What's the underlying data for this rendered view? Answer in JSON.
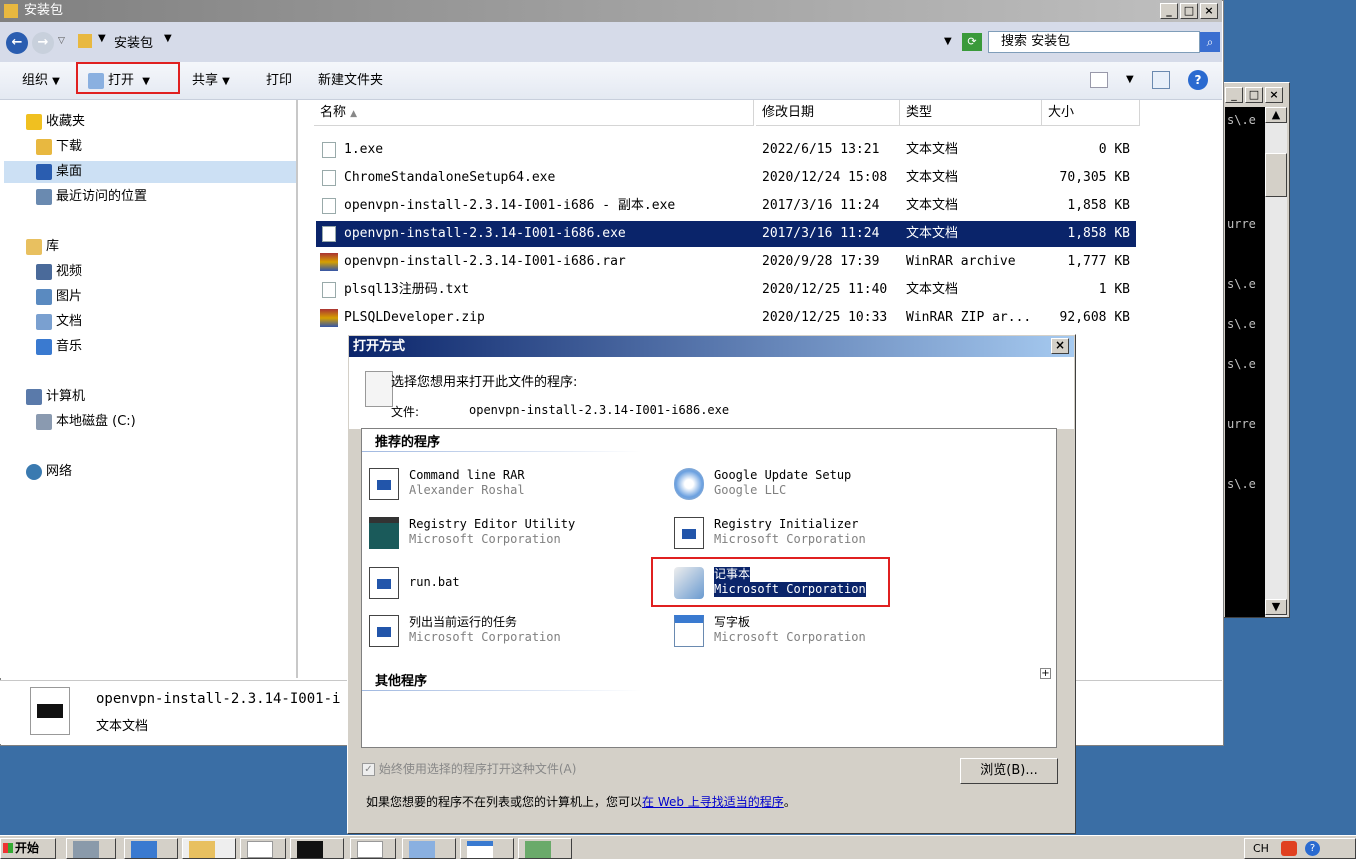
{
  "window": {
    "title": "安装包"
  },
  "address": {
    "breadcrumb": "安装包",
    "search_placeholder": "搜索 安装包"
  },
  "toolbar": {
    "organize": "组织",
    "open": "打开",
    "share": "共享",
    "print": "打印",
    "new_folder": "新建文件夹"
  },
  "nav": {
    "favorites": "收藏夹",
    "downloads": "下载",
    "desktop": "桌面",
    "recent": "最近访问的位置",
    "libraries": "库",
    "videos": "视频",
    "pictures": "图片",
    "documents": "文档",
    "music": "音乐",
    "computer": "计算机",
    "local_disk": "本地磁盘 (C:)",
    "network": "网络"
  },
  "columns": {
    "name": "名称",
    "modified": "修改日期",
    "type": "类型",
    "size": "大小"
  },
  "files": [
    {
      "name": "1.exe",
      "date": "2022/6/15 13:21",
      "type": "文本文档",
      "size": "0 KB"
    },
    {
      "name": "ChromeStandaloneSetup64.exe",
      "date": "2020/12/24 15:08",
      "type": "文本文档",
      "size": "70,305 KB"
    },
    {
      "name": "openvpn-install-2.3.14-I001-i686 - 副本.exe",
      "date": "2017/3/16 11:24",
      "type": "文本文档",
      "size": "1,858 KB"
    },
    {
      "name": "openvpn-install-2.3.14-I001-i686.exe",
      "date": "2017/3/16 11:24",
      "type": "文本文档",
      "size": "1,858 KB"
    },
    {
      "name": "openvpn-install-2.3.14-I001-i686.rar",
      "date": "2020/9/28 17:39",
      "type": "WinRAR archive",
      "size": "1,777 KB"
    },
    {
      "name": "plsql13注册码.txt",
      "date": "2020/12/25 11:40",
      "type": "文本文档",
      "size": "1 KB"
    },
    {
      "name": "PLSQLDeveloper.zip",
      "date": "2020/12/25 10:33",
      "type": "WinRAR ZIP ar...",
      "size": "92,608 KB"
    }
  ],
  "details": {
    "name": "openvpn-install-2.3.14-I001-i",
    "type": "文本文档"
  },
  "dialog": {
    "title": "打开方式",
    "prompt": "选择您想用来打开此文件的程序:",
    "file_label": "文件:",
    "file_name": "openvpn-install-2.3.14-I001-i686.exe",
    "recommended": "推荐的程序",
    "other": "其他程序",
    "programs": [
      {
        "name": "Command line RAR",
        "company": "Alexander Roshal"
      },
      {
        "name": "Google Update Setup",
        "company": "Google LLC"
      },
      {
        "name": "Registry Editor Utility",
        "company": "Microsoft Corporation"
      },
      {
        "name": "Registry Initializer",
        "company": "Microsoft Corporation"
      },
      {
        "name": "run.bat",
        "company": ""
      },
      {
        "name": "记事本",
        "company": "Microsoft Corporation"
      },
      {
        "name": "列出当前运行的任务",
        "company": "Microsoft Corporation"
      },
      {
        "name": "写字板",
        "company": "Microsoft Corporation"
      }
    ],
    "always_use": "始终使用选择的程序打开这种文件(A)",
    "browse": "浏览(B)...",
    "footer_text": "如果您想要的程序不在列表或您的计算机上，您可以",
    "footer_link": "在 Web 上寻找适当的程序",
    "footer_end": "。"
  },
  "console": {
    "lines": [
      "s\\.e",
      "urre",
      "s\\.e",
      "s\\.e",
      "s\\.e",
      "urre",
      "s\\.e"
    ]
  },
  "taskbar": {
    "start": "开始",
    "lang": "CH"
  }
}
